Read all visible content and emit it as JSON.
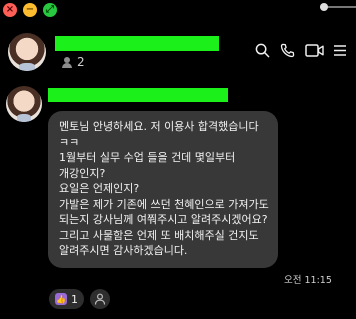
{
  "window": {
    "controls": [
      {
        "name": "close",
        "glyph": "×",
        "color": "#ff5f57"
      },
      {
        "name": "minimize",
        "glyph": "−",
        "color": "#febc2e"
      },
      {
        "name": "zoom",
        "glyph": "⤢",
        "color": "#28c840"
      }
    ]
  },
  "header": {
    "member_count": "2",
    "actions": [
      "search-icon",
      "phone-icon",
      "video-icon",
      "more-icon"
    ]
  },
  "message": {
    "text": "멘토님 안녕하세요. 저 이용사 합격했습니다 ㅋㅋ\n1월부터 실무 수업 들을 건데 몇일부터 개강인지?\n요일은 언제인지?\n가발은 제가 기존에 쓰던 천혜인으로 가져가도 되는지 강사님께 여쭤주시고 알려주시겠어요?\n그리고 사물함은 언제 또 배치해주실 건지도 알려주시면 감사하겠습니다.",
    "time": "오전 11:15",
    "reactions": [
      {
        "icon": "thumbs-up-icon",
        "count": "1"
      }
    ]
  },
  "colors": {
    "background": "#000000",
    "bubble": "#383838",
    "redaction": "#1bf01b",
    "reaction_accent": "#9a6ad6"
  }
}
